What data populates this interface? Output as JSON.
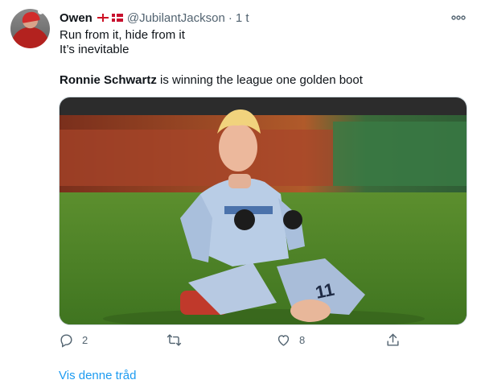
{
  "tweet": {
    "author_name": "Owen",
    "author_handle": "@JubilantJackson",
    "separator": "·",
    "time": "1 t",
    "more_icon": "more-horizontal-icon",
    "text_line1": "Run from it, hide from it",
    "text_line2": "It’s inevitable",
    "mention_bold": "Ronnie Schwartz",
    "mention_rest": " is winning the league one golden boot",
    "flags": [
      "england-flag",
      "denmark-flag"
    ]
  },
  "actions": {
    "reply_count": "2",
    "retweet_count": "",
    "like_count": "8",
    "icons": [
      "reply-icon",
      "retweet-icon",
      "like-icon",
      "share-icon"
    ]
  },
  "thread_link": "Vis denne tråd",
  "colors": {
    "link": "#1d9bf0",
    "muted": "#536471",
    "text": "#0f1419"
  }
}
